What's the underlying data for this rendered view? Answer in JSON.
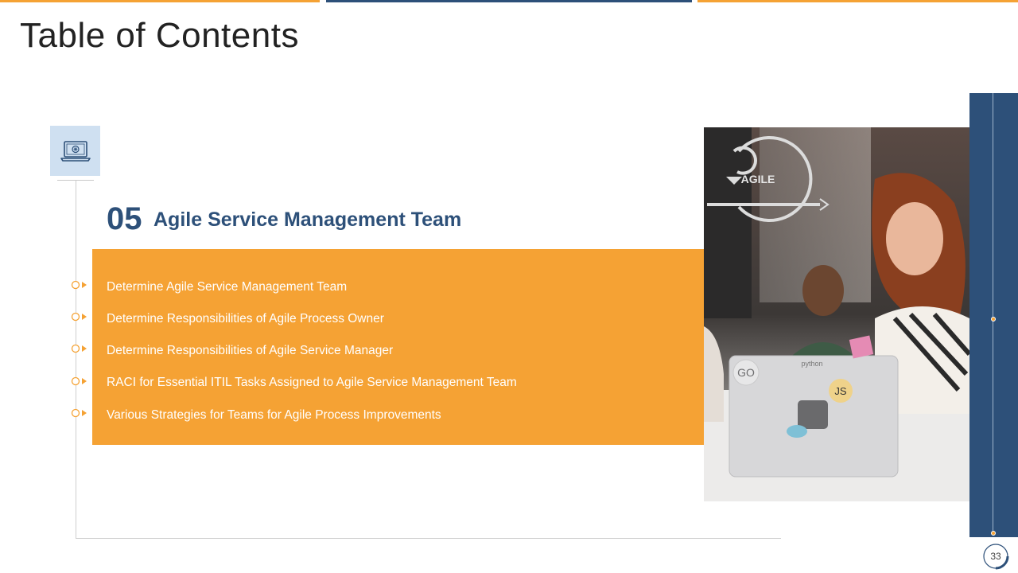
{
  "slide": {
    "title": "Table of Contents",
    "page_number": "33"
  },
  "section": {
    "number": "05",
    "title": "Agile Service Management Team",
    "icon": "laptop-icon"
  },
  "items": [
    "Determine Agile Service Management Team",
    "Determine Responsibilities of Agile Process Owner",
    "Determine Responsibilities of Agile Service Manager",
    "RACI for Essential ITIL Tasks Assigned to Agile Service Management Team",
    "Various Strategies for Teams for Agile Process Improvements"
  ],
  "photo": {
    "agile_label": "AGILE",
    "sticker_go": "GO",
    "sticker_js": "JS",
    "laptop_text": "python"
  },
  "colors": {
    "accent_orange": "#f5a234",
    "navy": "#2d5079",
    "icon_bg": "#cfe0f1"
  }
}
